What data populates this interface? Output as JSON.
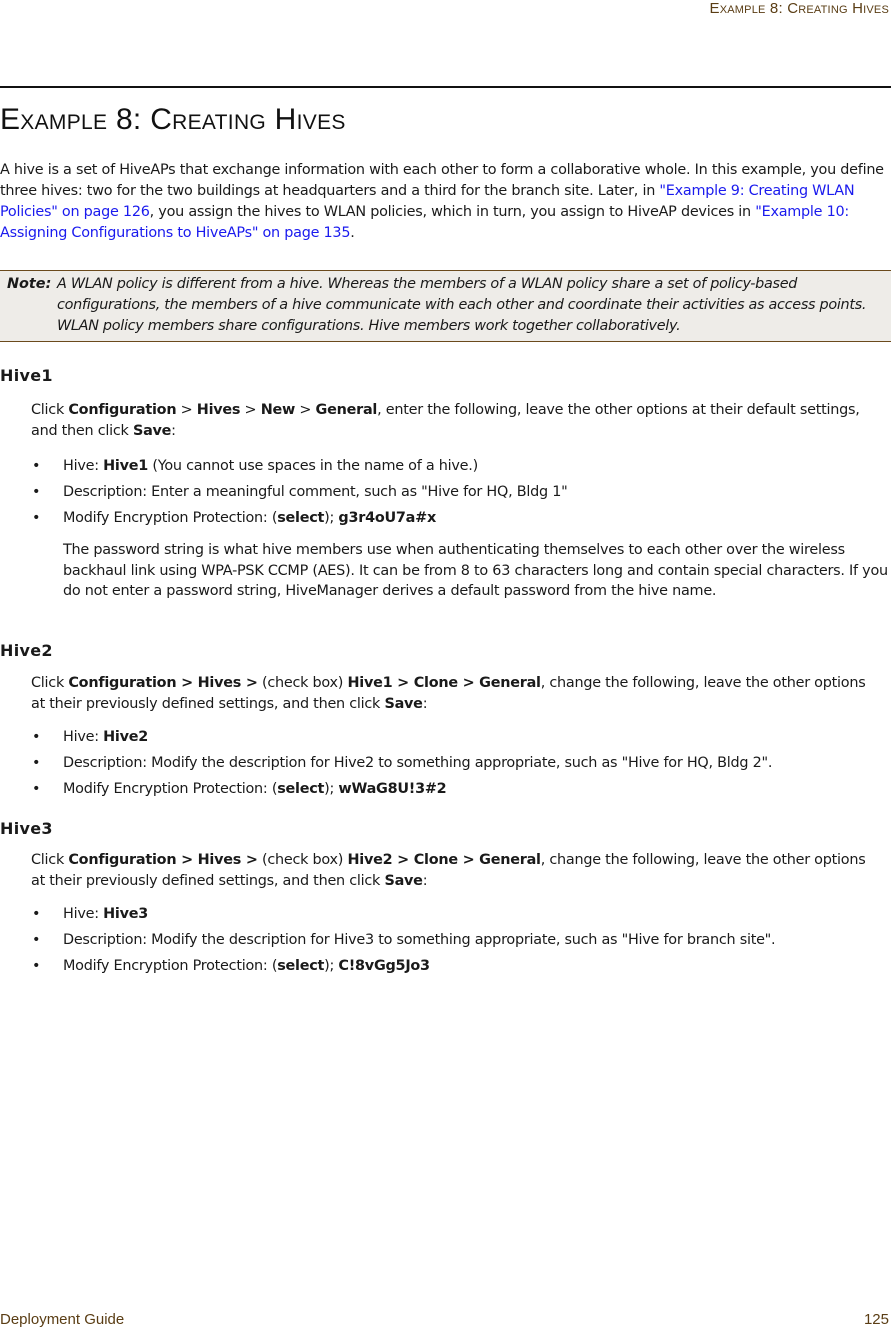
{
  "header": {
    "running_title": "Example 8: Creating Hives"
  },
  "chapter": {
    "title": "Example 8: Creating Hives"
  },
  "intro": {
    "text_1": "A hive is a set of HiveAPs that exchange information with each other to form a collaborative whole. In this example, you define three hives: two for the two buildings at headquarters and a third for the branch site. Later, in ",
    "link_1": "\"Example 9: Creating WLAN Policies\" on page 126",
    "text_2": ", you assign the hives to WLAN policies, which in turn, you assign to HiveAP devices in ",
    "link_2": "\"Example 10: Assigning Configurations to HiveAPs\" on page 135",
    "text_3": "."
  },
  "note": {
    "label": "Note:",
    "text": "A WLAN policy is different from a hive. Whereas the members of a WLAN policy share a set of policy-based configurations, the members of a hive communicate with each other and coordinate their activities as access points. WLAN policy members share configurations. Hive members work together collaboratively."
  },
  "sections": [
    {
      "heading": "Hive1",
      "instruction": {
        "click": "Click ",
        "path": [
          {
            "label": "Configuration",
            "sep": " > "
          },
          {
            "label": "Hives",
            "sep": " > "
          },
          {
            "label": "New",
            "sep": " > "
          },
          {
            "label": "General",
            "sep": ""
          }
        ],
        "rest": ", enter the following, leave the other options at their default settings, and then click ",
        "save": "Save",
        "colon": ":"
      },
      "bullets": [
        {
          "prefix": "Hive: ",
          "value": "Hive1",
          "suffix": " (You cannot use spaces in the name of a hive.)"
        },
        {
          "prefix": "Description: Enter a meaningful comment, such as \"Hive for HQ, Bldg 1\"",
          "value": "",
          "suffix": ""
        },
        {
          "prefix": "Modify Encryption Protection: (",
          "select": "select",
          "mid": "); ",
          "value": "g3r4oU7a#x",
          "suffix": ""
        }
      ],
      "explanation": "The password string is what hive members use when authenticating themselves to each other over the wireless backhaul link using WPA-PSK CCMP (AES). It can be from 8 to 63 characters long and contain special characters. If you do not enter a password string, HiveManager derives a default password from the hive name."
    },
    {
      "heading": "Hive2",
      "instruction": {
        "click": "Click ",
        "p1": "Configuration > Hives >",
        "checkbox": " (check box) ",
        "p2": "Hive1 > Clone > General",
        "rest": ", change the following, leave the other options at their previously defined settings, and then click ",
        "save": "Save",
        "colon": ":"
      },
      "bullets": [
        {
          "prefix": "Hive: ",
          "value": "Hive2",
          "suffix": ""
        },
        {
          "prefix": "Description: Modify the description for Hive2 to something appropriate, such as \"Hive for HQ, Bldg 2\".",
          "value": "",
          "suffix": ""
        },
        {
          "prefix": "Modify Encryption Protection: (",
          "select": "select",
          "mid": "); ",
          "value": "wWaG8U!3#2",
          "suffix": ""
        }
      ]
    },
    {
      "heading": "Hive3",
      "instruction": {
        "click": "Click ",
        "p1": "Configuration > Hives >",
        "checkbox": " (check box) ",
        "p2": "Hive2 > Clone > General",
        "rest": ", change the following, leave the other options at their previously defined settings, and then click ",
        "save": "Save",
        "colon": ":"
      },
      "bullets": [
        {
          "prefix": "Hive: ",
          "value": "Hive3",
          "suffix": ""
        },
        {
          "prefix": "Description: Modify the description for Hive3 to something appropriate, such as \"Hive for branch site\".",
          "value": "",
          "suffix": ""
        },
        {
          "prefix": "Modify Encryption Protection: (",
          "select": "select",
          "mid": "); ",
          "value": "C!8vGg5Jo3",
          "suffix": ""
        }
      ]
    }
  ],
  "bullet_glyph": "•",
  "footer": {
    "doc_title": "Deployment Guide",
    "page_number": "125"
  },
  "colors": {
    "header_footer_text": "#5a3d14",
    "link": "#1a1aee",
    "note_background": "#eeece8",
    "note_border": "#6b4a1c"
  }
}
